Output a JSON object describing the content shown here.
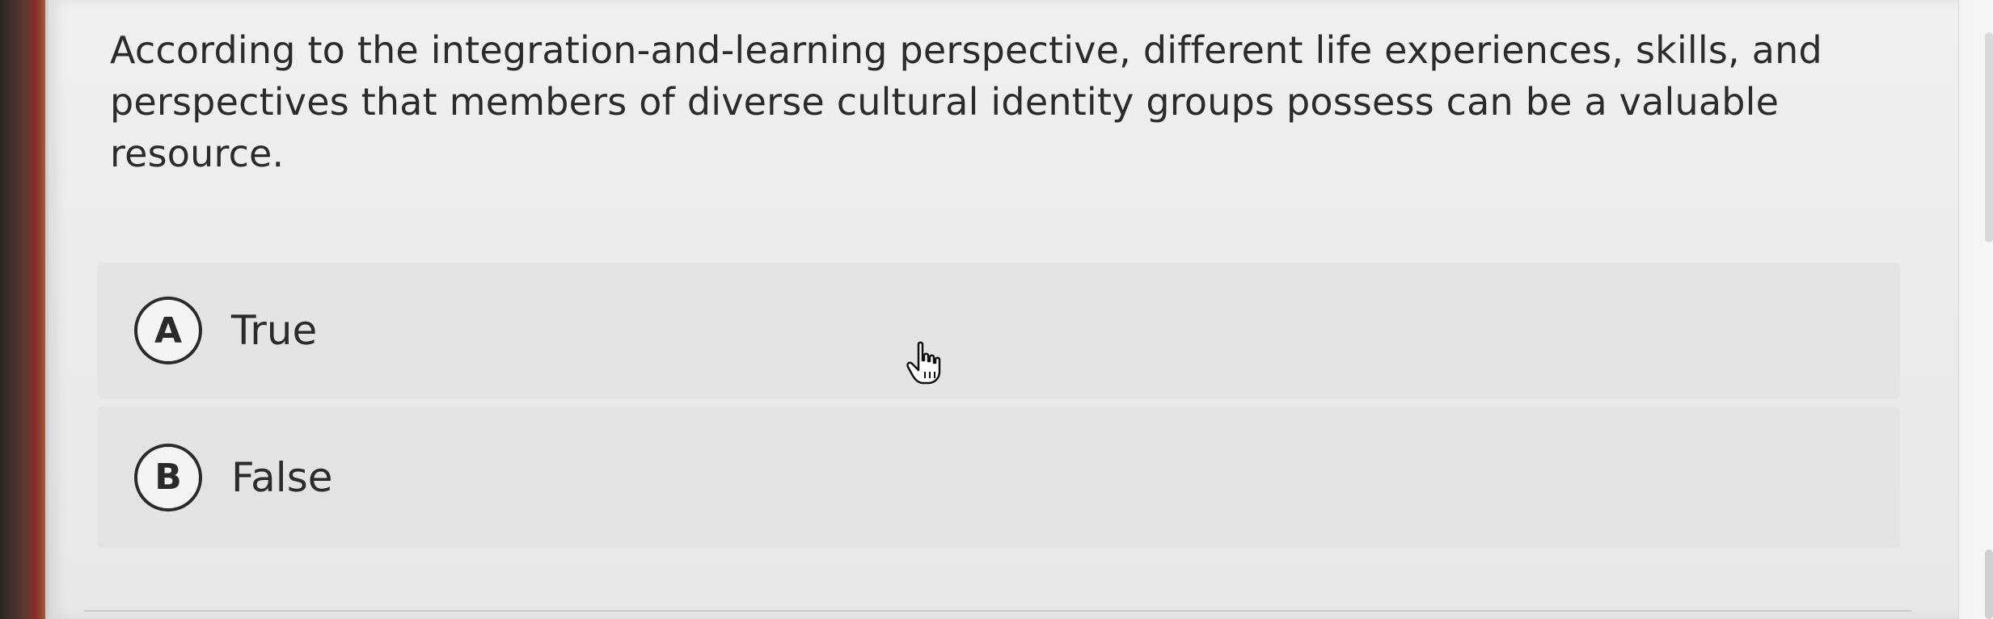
{
  "question": {
    "text": "According to the integration-and-learning perspective, different life experiences, skills, and perspectives that members of diverse cultural identity groups possess can be a valuable resource."
  },
  "options": [
    {
      "letter": "A",
      "label": "True"
    },
    {
      "letter": "B",
      "label": "False"
    }
  ],
  "cursor": {
    "icon": "hand-pointer-icon"
  },
  "colors": {
    "background": "#ececed",
    "option_bg": "#e4e4e6",
    "text": "#2b2b2d",
    "badge_border": "#2a2a2c"
  }
}
